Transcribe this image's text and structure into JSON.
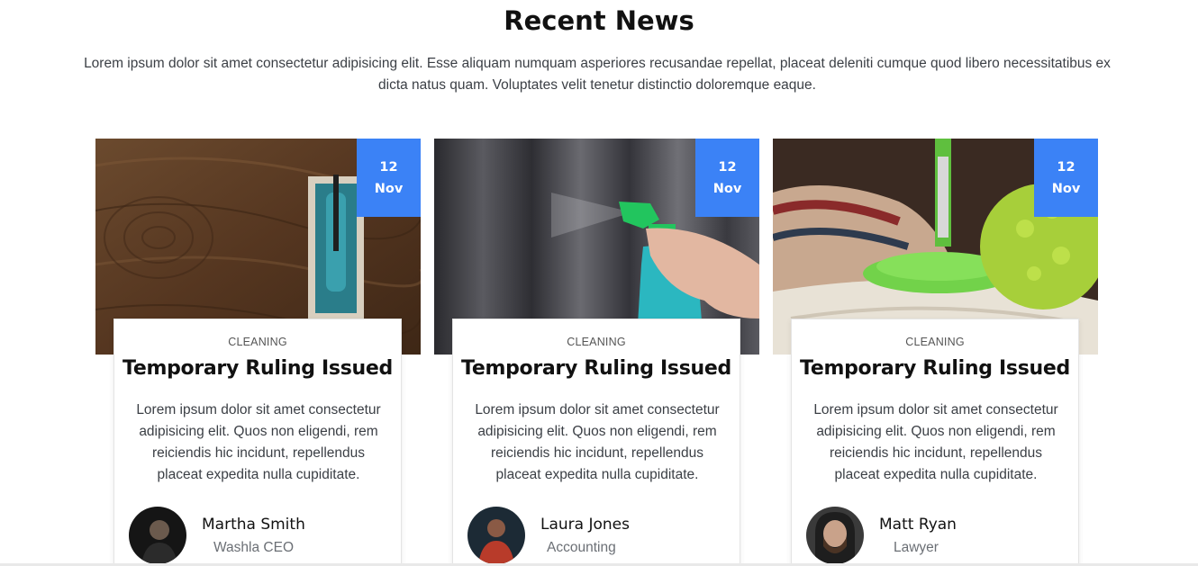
{
  "section": {
    "title": "Recent News",
    "description": "Lorem ipsum dolor sit amet consectetur adipisicing elit. Esse aliquam numquam asperiores recusandae repellat, placeat deleniti cumque quod libero necessitatibus ex dicta natus quam. Voluptates velit tenetur distinctio doloremque eaque."
  },
  "cards": [
    {
      "date_day": "12",
      "date_month": "Nov",
      "category": "CLEANING",
      "title": "Temporary Ruling Issued",
      "text": "Lorem ipsum dolor sit amet consectetur adipisicing elit. Quos non eligendi, rem reiciendis hic incidunt, repellendus placeat expedita nulla cupiditate.",
      "author_name": "Martha Smith",
      "author_role": "Washla CEO"
    },
    {
      "date_day": "12",
      "date_month": "Nov",
      "category": "CLEANING",
      "title": "Temporary Ruling Issued",
      "text": "Lorem ipsum dolor sit amet consectetur adipisicing elit. Quos non eligendi, rem reiciendis hic incidunt, repellendus placeat expedita nulla cupiditate.",
      "author_name": "Laura Jones",
      "author_role": "Accounting"
    },
    {
      "date_day": "12",
      "date_month": "Nov",
      "category": "CLEANING",
      "title": "Temporary Ruling Issued",
      "text": "Lorem ipsum dolor sit amet consectetur adipisicing elit. Quos non eligendi, rem reiciendis hic incidunt, repellendus placeat expedita nulla cupiditate.",
      "author_name": "Matt Ryan",
      "author_role": "Lawyer"
    }
  ],
  "colors": {
    "accent": "#3b82f6"
  }
}
